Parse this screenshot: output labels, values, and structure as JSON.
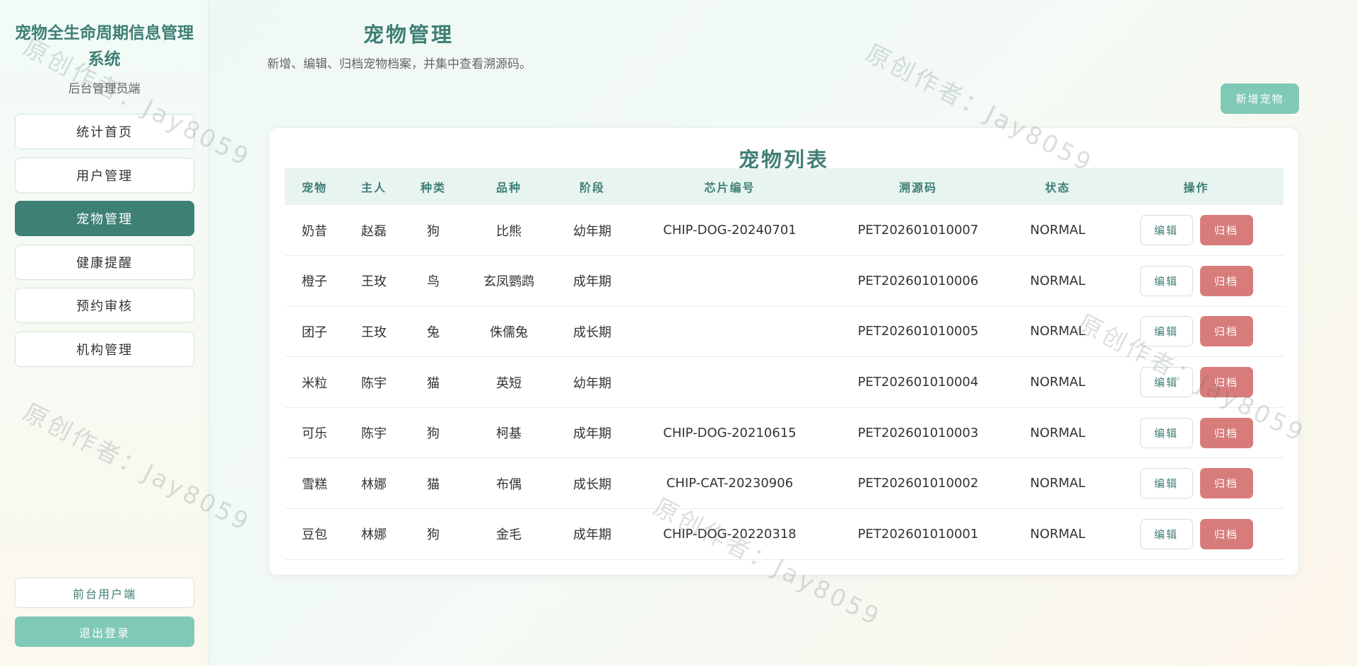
{
  "app": {
    "title": "宠物全生命周期信息管理系统",
    "role": "后台管理员端"
  },
  "sidebar": {
    "items": [
      {
        "label": "统计首页",
        "active": false
      },
      {
        "label": "用户管理",
        "active": false
      },
      {
        "label": "宠物管理",
        "active": true
      },
      {
        "label": "健康提醒",
        "active": false
      },
      {
        "label": "预约审核",
        "active": false
      },
      {
        "label": "机构管理",
        "active": false
      }
    ],
    "front_label": "前台用户端",
    "logout_label": "退出登录"
  },
  "header": {
    "title": "宠物管理",
    "subtitle": "新增、编辑、归档宠物档案，并集中查看溯源码。",
    "add_label": "新增宠物"
  },
  "table": {
    "title": "宠物列表",
    "columns": [
      "宠物",
      "主人",
      "种类",
      "品种",
      "阶段",
      "芯片编号",
      "溯源码",
      "状态",
      "操作"
    ],
    "rows": [
      {
        "pet": "奶昔",
        "owner": "赵磊",
        "species": "狗",
        "breed": "比熊",
        "stage": "幼年期",
        "chip": "CHIP-DOG-20240701",
        "trace": "PET202601010007",
        "status": "NORMAL"
      },
      {
        "pet": "橙子",
        "owner": "王玫",
        "species": "鸟",
        "breed": "玄凤鹦鹉",
        "stage": "成年期",
        "chip": "",
        "trace": "PET202601010006",
        "status": "NORMAL"
      },
      {
        "pet": "团子",
        "owner": "王玫",
        "species": "兔",
        "breed": "侏儒兔",
        "stage": "成长期",
        "chip": "",
        "trace": "PET202601010005",
        "status": "NORMAL"
      },
      {
        "pet": "米粒",
        "owner": "陈宇",
        "species": "猫",
        "breed": "英短",
        "stage": "幼年期",
        "chip": "",
        "trace": "PET202601010004",
        "status": "NORMAL"
      },
      {
        "pet": "可乐",
        "owner": "陈宇",
        "species": "狗",
        "breed": "柯基",
        "stage": "成年期",
        "chip": "CHIP-DOG-20210615",
        "trace": "PET202601010003",
        "status": "NORMAL"
      },
      {
        "pet": "雪糕",
        "owner": "林娜",
        "species": "猫",
        "breed": "布偶",
        "stage": "成长期",
        "chip": "CHIP-CAT-20230906",
        "trace": "PET202601010002",
        "status": "NORMAL"
      },
      {
        "pet": "豆包",
        "owner": "林娜",
        "species": "狗",
        "breed": "金毛",
        "stage": "成年期",
        "chip": "CHIP-DOG-20220318",
        "trace": "PET202601010001",
        "status": "NORMAL"
      }
    ],
    "edit_label": "编辑",
    "archive_label": "归档"
  },
  "watermark": "原创作者：Jay8059",
  "colors": {
    "primary": "#3e8075",
    "accent": "#7fc9b6",
    "danger": "#d87b7b"
  }
}
